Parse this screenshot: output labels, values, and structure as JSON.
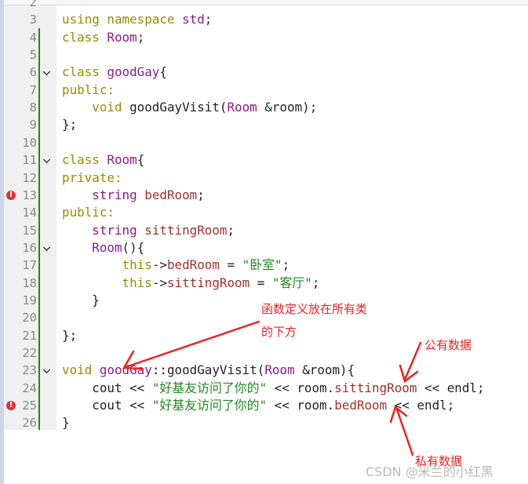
{
  "editor": {
    "lines": [
      {
        "n": "2",
        "tokens": []
      },
      {
        "n": "3",
        "tokens": [
          [
            "using namespace ",
            "kw"
          ],
          [
            "std",
            "ty"
          ],
          [
            ";",
            "pl"
          ]
        ]
      },
      {
        "n": "4",
        "tokens": [
          [
            "class ",
            "kw"
          ],
          [
            "Room",
            "ty"
          ],
          [
            ";",
            "pl"
          ]
        ]
      },
      {
        "n": "5",
        "tokens": []
      },
      {
        "n": "6",
        "fold": true,
        "tokens": [
          [
            "class ",
            "kw"
          ],
          [
            "goodGay",
            "ty"
          ],
          [
            "{",
            "pl"
          ]
        ]
      },
      {
        "n": "7",
        "tokens": [
          [
            "public:",
            "kw"
          ]
        ]
      },
      {
        "n": "8",
        "tokens": [
          [
            "    void ",
            "kw"
          ],
          [
            "goodGayVisit(",
            "pl"
          ],
          [
            "Room",
            "ty"
          ],
          [
            " &room);",
            "pl"
          ]
        ]
      },
      {
        "n": "9",
        "tokens": [
          [
            "};",
            "pl"
          ]
        ]
      },
      {
        "n": "10",
        "tokens": []
      },
      {
        "n": "11",
        "fold": true,
        "tokens": [
          [
            "class ",
            "kw"
          ],
          [
            "Room",
            "ty"
          ],
          [
            "{",
            "pl"
          ]
        ]
      },
      {
        "n": "12",
        "tokens": [
          [
            "private:",
            "kw"
          ]
        ]
      },
      {
        "n": "13",
        "error": true,
        "tokens": [
          [
            "    string ",
            "ty"
          ],
          [
            "bedRoom",
            "mb"
          ],
          [
            ";",
            "pl"
          ]
        ]
      },
      {
        "n": "14",
        "tokens": [
          [
            "public:",
            "kw"
          ]
        ]
      },
      {
        "n": "15",
        "tokens": [
          [
            "    string ",
            "ty"
          ],
          [
            "sittingRoom",
            "mb"
          ],
          [
            ";",
            "pl"
          ]
        ]
      },
      {
        "n": "16",
        "fold": true,
        "tokens": [
          [
            "    Room",
            "ty"
          ],
          [
            "(){",
            "pl"
          ]
        ]
      },
      {
        "n": "17",
        "tokens": [
          [
            "        this",
            "kw"
          ],
          [
            "->",
            "pl"
          ],
          [
            "bedRoom",
            "mb"
          ],
          [
            " = ",
            "pl"
          ],
          [
            "\"卧室\"",
            "st"
          ],
          [
            ";",
            "pl"
          ]
        ]
      },
      {
        "n": "18",
        "tokens": [
          [
            "        this",
            "kw"
          ],
          [
            "->",
            "pl"
          ],
          [
            "sittingRoom",
            "mb"
          ],
          [
            " = ",
            "pl"
          ],
          [
            "\"客厅\"",
            "st"
          ],
          [
            ";",
            "pl"
          ]
        ]
      },
      {
        "n": "19",
        "tokens": [
          [
            "    }",
            "pl"
          ]
        ]
      },
      {
        "n": "20",
        "tokens": []
      },
      {
        "n": "21",
        "tokens": [
          [
            "};",
            "pl"
          ]
        ]
      },
      {
        "n": "22",
        "tokens": []
      },
      {
        "n": "23",
        "fold": true,
        "tokens": [
          [
            "void ",
            "kw"
          ],
          [
            "goodGay",
            "ty"
          ],
          [
            "::goodGayVisit(",
            "pl"
          ],
          [
            "Room",
            "ty"
          ],
          [
            " &room){",
            "pl"
          ]
        ]
      },
      {
        "n": "24",
        "tokens": [
          [
            "    cout << ",
            "pl"
          ],
          [
            "\"好基友访问了你的\"",
            "st"
          ],
          [
            " << room.",
            "pl"
          ],
          [
            "sittingRoom",
            "mb"
          ],
          [
            " << endl;",
            "pl"
          ]
        ]
      },
      {
        "n": "25",
        "error": true,
        "tokens": [
          [
            "    cout << ",
            "pl"
          ],
          [
            "\"好基友访问了你的\"",
            "st"
          ],
          [
            " << room.",
            "pl"
          ],
          [
            "bedRoom",
            "mb"
          ],
          [
            " << endl;",
            "pl"
          ]
        ]
      },
      {
        "n": "26",
        "tokens": [
          [
            "}",
            "pl"
          ]
        ]
      }
    ]
  },
  "annotations": {
    "note1_line1": "函数定义放在所有类",
    "note1_line2": "的下方",
    "note2": "公有数据",
    "note3": "私有数据",
    "color": "#ee2222"
  },
  "watermark": "CSDN @米兰的小红黑"
}
